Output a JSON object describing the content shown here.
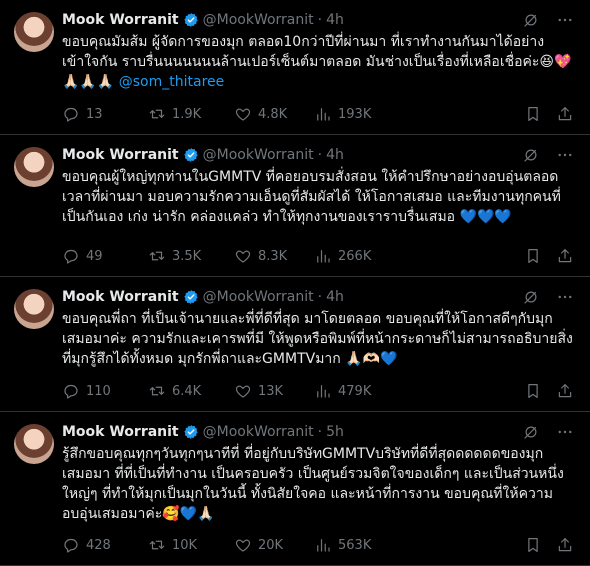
{
  "colors": {
    "background": "#000000",
    "text": "#e7e9ea",
    "muted": "#71767b",
    "accent": "#1d9bf0",
    "divider": "#2f3336"
  },
  "tweets": [
    {
      "name": "Mook Worranit",
      "handle": "@MookWorranit",
      "time": "4h",
      "text": "ขอบคุณมัมส้ม ผู้จัดการของมุก ตลอด10กว่าปีที่ผ่านมา ที่เราทำงานกันมาได้อย่าง\nเข้าใจกัน ราบรื่นนนนนนนล้านเปอร์เซ็นต์มาตลอด มันช่างเป็นเรื่องที่เหลือเชื่อค่ะ😆💖\n🙏🏻🙏🏻🙏🏻 ",
      "mention": "@som_thitaree",
      "replies": "13",
      "retweets": "1.9K",
      "likes": "4.8K",
      "views": "193K"
    },
    {
      "name": "Mook Worranit",
      "handle": "@MookWorranit",
      "time": "4h",
      "text": "ขอบคุณผู้ใหญ่ทุกท่านในGMMTV ที่คอยอบรมสั่งสอน ให้คำปรึกษาอย่างอบอุ่นตลอด\nเวลาที่ผ่านมา มอบความรักความเอ็นดูที่สัมผัสได้ ให้โอกาสเสมอ และทีมงานทุกคนที่\nเป็นกันเอง เก่ง น่ารัก คล่องแคล่ว ทำให้ทุกงานของเราราบรื่นเสมอ 💙💙💙",
      "mention": "",
      "replies": "49",
      "retweets": "3.5K",
      "likes": "8.3K",
      "views": "266K"
    },
    {
      "name": "Mook Worranit",
      "handle": "@MookWorranit",
      "time": "4h",
      "text": "ขอบคุณพี่ถา ที่เป็นเจ้านายและพี่ที่ดีที่สุด มาโดยตลอด ขอบคุณที่ให้โอกาสดีๆกับมุก\nเสมอมาค่ะ ความรักและเคารพที่มี ให้พูดหรือพิมพ์ที่หน้ากระดาษก็ไม่สามารถอธิบายสิ่ง\nที่มุกรู้สึกได้ทั้งหมด มุกรักพี่ถาและGMMTVมาก 🙏🏻🫶🏻💙",
      "mention": "",
      "replies": "110",
      "retweets": "6.4K",
      "likes": "13K",
      "views": "479K"
    },
    {
      "name": "Mook Worranit",
      "handle": "@MookWorranit",
      "time": "5h",
      "text": "รู้สึกขอบคุณทุกๆวันทุกๆนาทีที่ ที่อยู่กับบริษัทGMMTVบริษัทที่ดีที่สุดดดดดดของมุก\nเสมอมา ที่ที่เป็นที่ทำงาน เป็นครอบครัว เป็นศูนย์รวมจิตใจของเด็กๆ และเป็นส่วนหนึ่ง\nใหญ่ๆ ที่ทำให้มุกเป็นมุกในวันนี้ ทั้งนิสัยใจคอ และหน้าที่การงาน ขอบคุณที่ให้ความ\nอบอุ่นเสมอมาค่ะ🥰💙🙏🏻",
      "mention": "",
      "replies": "428",
      "retweets": "10K",
      "likes": "20K",
      "views": "563K"
    }
  ]
}
